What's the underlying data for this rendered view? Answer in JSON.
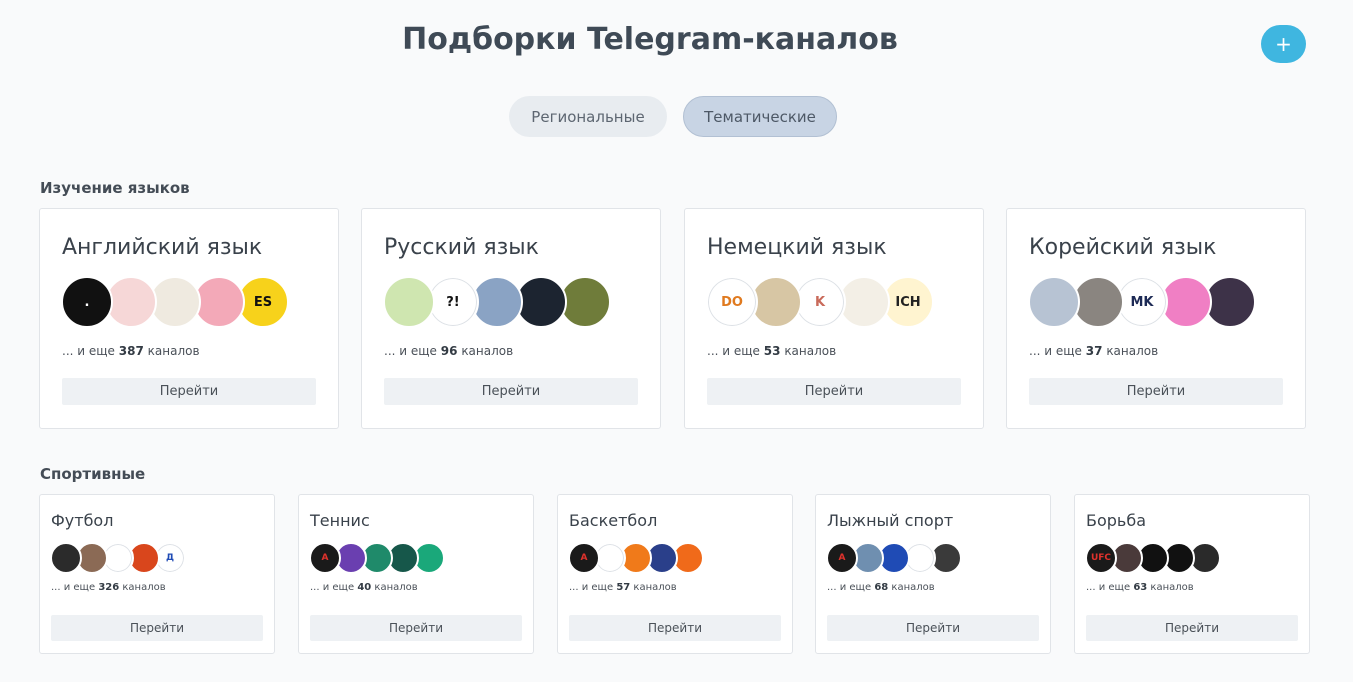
{
  "header": {
    "title": "Подборки Telegram-каналов",
    "add_label": "+"
  },
  "tabs": [
    {
      "label": "Региональные"
    },
    {
      "label": "Тематические"
    }
  ],
  "sections": [
    {
      "title": "Изучение языков",
      "cards": [
        {
          "name": "Английский язык",
          "more_prefix": "... и еще",
          "count": "387",
          "more_suffix": "каналов",
          "button": "Перейти",
          "avatars": [
            {
              "bg": "#111111",
              "fg": "#ffffff",
              "text": "."
            },
            {
              "bg": "#f6d7d7",
              "fg": "#e05a5a",
              "text": ""
            },
            {
              "bg": "#efeae0",
              "fg": "#666666",
              "text": ""
            },
            {
              "bg": "#f3a9b8",
              "fg": "#3b2a2a",
              "text": ""
            },
            {
              "bg": "#f7d21b",
              "fg": "#111111",
              "text": "ES"
            }
          ]
        },
        {
          "name": "Русский язык",
          "more_prefix": "... и еще",
          "count": "96",
          "more_suffix": "каналов",
          "button": "Перейти",
          "avatars": [
            {
              "bg": "#cfe6b0",
              "fg": "#6b5a2a",
              "text": ""
            },
            {
              "bg": "#ffffff",
              "fg": "#111111",
              "text": "?!"
            },
            {
              "bg": "#8aa3c4",
              "fg": "#ffffff",
              "text": ""
            },
            {
              "bg": "#1c2430",
              "fg": "#e0e0e0",
              "text": ""
            },
            {
              "bg": "#6f7c3a",
              "fg": "#e7d8a0",
              "text": ""
            }
          ]
        },
        {
          "name": "Немецкий язык",
          "more_prefix": "... и еще",
          "count": "53",
          "more_suffix": "каналов",
          "button": "Перейти",
          "avatars": [
            {
              "bg": "#ffffff",
              "fg": "#e07a1f",
              "text": "DO"
            },
            {
              "bg": "#d7c6a4",
              "fg": "#7a1d1d",
              "text": ""
            },
            {
              "bg": "#ffffff",
              "fg": "#c96a5a",
              "text": "K"
            },
            {
              "bg": "#f3efe6",
              "fg": "#333333",
              "text": ""
            },
            {
              "bg": "#fff4d0",
              "fg": "#222222",
              "text": "ICH"
            }
          ]
        },
        {
          "name": "Корейский язык",
          "more_prefix": "... и еще",
          "count": "37",
          "more_suffix": "каналов",
          "button": "Перейти",
          "avatars": [
            {
              "bg": "#b7c3d3",
              "fg": "#c0392b",
              "text": ""
            },
            {
              "bg": "#8a8580",
              "fg": "#ffffff",
              "text": ""
            },
            {
              "bg": "#ffffff",
              "fg": "#1d2a55",
              "text": "MK"
            },
            {
              "bg": "#f07fc4",
              "fg": "#2a2a2a",
              "text": ""
            },
            {
              "bg": "#3d3248",
              "fg": "#b8a8d0",
              "text": ""
            }
          ]
        }
      ]
    },
    {
      "title": "Спортивные",
      "cards": [
        {
          "name": "Футбол",
          "more_prefix": "... и еще",
          "count": "326",
          "more_suffix": "каналов",
          "button": "Перейти",
          "avatars": [
            {
              "bg": "#2b2b2b",
              "fg": "#f0c000",
              "text": ""
            },
            {
              "bg": "#8b6a55",
              "fg": "#ffffff",
              "text": ""
            },
            {
              "bg": "#ffffff",
              "fg": "#d0312d",
              "text": ""
            },
            {
              "bg": "#d9461c",
              "fg": "#ffffff",
              "text": ""
            },
            {
              "bg": "#ffffff",
              "fg": "#1f4bb5",
              "text": "Д"
            }
          ]
        },
        {
          "name": "Теннис",
          "more_prefix": "... и еще",
          "count": "40",
          "more_suffix": "каналов",
          "button": "Перейти",
          "avatars": [
            {
              "bg": "#1a1a1a",
              "fg": "#e0322c",
              "text": "A"
            },
            {
              "bg": "#6a3fb0",
              "fg": "#c8f03a",
              "text": ""
            },
            {
              "bg": "#1f8a6a",
              "fg": "#ffffff",
              "text": ""
            },
            {
              "bg": "#16574a",
              "fg": "#ffffff",
              "text": ""
            },
            {
              "bg": "#1aa87a",
              "fg": "#ffffff",
              "text": ""
            }
          ]
        },
        {
          "name": "Баскетбол",
          "more_prefix": "... и еще",
          "count": "57",
          "more_suffix": "каналов",
          "button": "Перейти",
          "avatars": [
            {
              "bg": "#1a1a1a",
              "fg": "#e0322c",
              "text": "A"
            },
            {
              "bg": "#ffffff",
              "fg": "#c0392b",
              "text": ""
            },
            {
              "bg": "#f07a1a",
              "fg": "#ffffff",
              "text": ""
            },
            {
              "bg": "#2a3f8a",
              "fg": "#f0c040",
              "text": ""
            },
            {
              "bg": "#f06a1a",
              "fg": "#ffffff",
              "text": ""
            }
          ]
        },
        {
          "name": "Лыжный спорт",
          "more_prefix": "... и еще",
          "count": "68",
          "more_suffix": "каналов",
          "button": "Перейти",
          "avatars": [
            {
              "bg": "#1a1a1a",
              "fg": "#e0322c",
              "text": "A"
            },
            {
              "bg": "#6f8fb0",
              "fg": "#ffffff",
              "text": ""
            },
            {
              "bg": "#1f4bb5",
              "fg": "#ffffff",
              "text": ""
            },
            {
              "bg": "#ffffff",
              "fg": "#3aa0d8",
              "text": ""
            },
            {
              "bg": "#3a3a3a",
              "fg": "#ffffff",
              "text": ""
            }
          ]
        },
        {
          "name": "Борьба",
          "more_prefix": "... и еще",
          "count": "63",
          "more_suffix": "каналов",
          "button": "Перейти",
          "avatars": [
            {
              "bg": "#1a1a1a",
              "fg": "#e0322c",
              "text": "UFC"
            },
            {
              "bg": "#4a3a3a",
              "fg": "#ffffff",
              "text": ""
            },
            {
              "bg": "#111111",
              "fg": "#ffffff",
              "text": ""
            },
            {
              "bg": "#111111",
              "fg": "#e0322c",
              "text": ""
            },
            {
              "bg": "#2a2a2a",
              "fg": "#ffffff",
              "text": ""
            }
          ]
        }
      ]
    }
  ]
}
